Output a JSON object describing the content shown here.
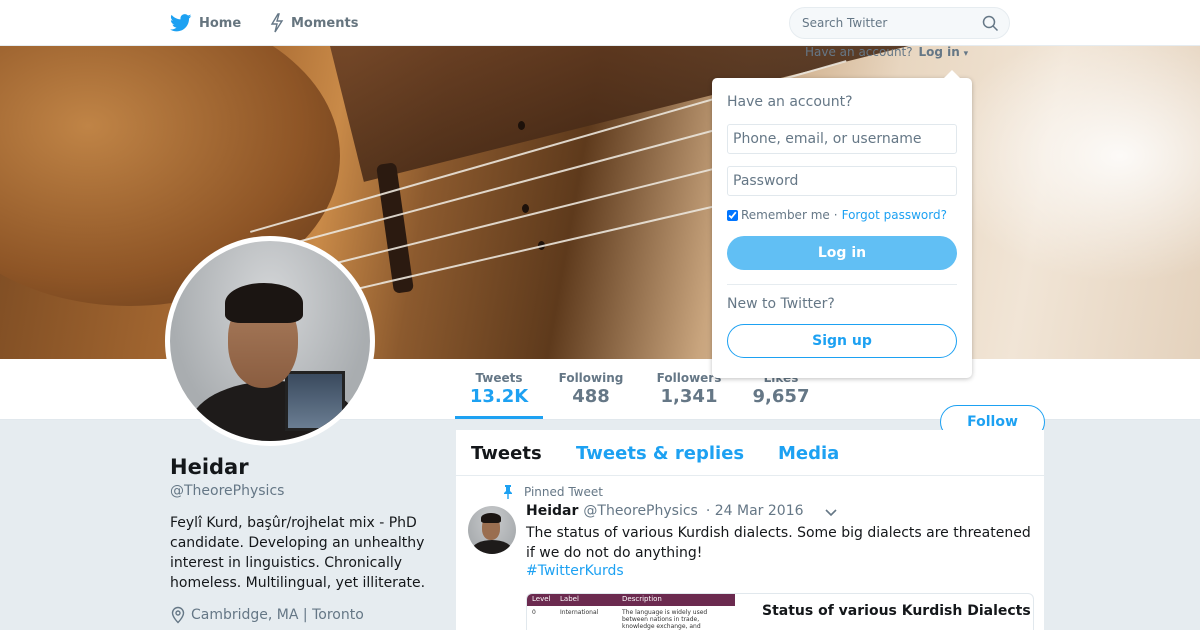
{
  "colors": {
    "accent": "#1da1f2",
    "text": "#14171a",
    "muted": "#657786",
    "background": "#e6ecf0"
  },
  "nav": {
    "home": {
      "label": "Home",
      "icon": "twitter-bird-icon"
    },
    "moments": {
      "label": "Moments",
      "icon": "lightning-icon"
    },
    "search": {
      "placeholder": "Search Twitter",
      "icon": "search-icon"
    }
  },
  "login": {
    "hint_text": "Have an account?",
    "hint_link": "Log in",
    "title": "Have an account?",
    "username_placeholder": "Phone, email, or username",
    "password_placeholder": "Password",
    "remember_label": "Remember me",
    "separator": "·",
    "forgot_link": "Forgot password?",
    "login_button": "Log in",
    "new_text": "New to Twitter?",
    "signup_button": "Sign up"
  },
  "stats": [
    {
      "label": "Tweets",
      "value": "13.2K",
      "active": true
    },
    {
      "label": "Following",
      "value": "488"
    },
    {
      "label": "Followers",
      "value": "1,341"
    },
    {
      "label": "Likes",
      "value": "9,657"
    }
  ],
  "follow_button": "Follow",
  "profile": {
    "name": "Heidar",
    "handle": "@TheorePhysics",
    "bio": "Feylî Kurd, başûr/rojhelat mix - PhD candidate. Developing an unhealthy interest in linguistics. Chronically homeless. Multilingual, yet illiterate.",
    "location": "Cambridge, MA | Toronto",
    "location_icon": "location-pin-icon"
  },
  "timeline": {
    "tabs": [
      "Tweets",
      "Tweets & replies",
      "Media"
    ],
    "tweet": {
      "pinned_label": "Pinned Tweet",
      "pin_icon": "pin-icon",
      "name": "Heidar",
      "handle": "@TheorePhysics",
      "date": "· 24 Mar 2016",
      "text": "The status of various Kurdish dialects. Some big dialects are threatened if we do not do anything!",
      "hashtag": "#TwitterKurds",
      "media": {
        "title": "Status of various Kurdish Dialects",
        "table_headers": [
          "Level",
          "Label",
          "Description"
        ],
        "table_row": [
          "0",
          "International",
          "The language is widely used between nations in trade, knowledge exchange, and"
        ]
      }
    }
  }
}
